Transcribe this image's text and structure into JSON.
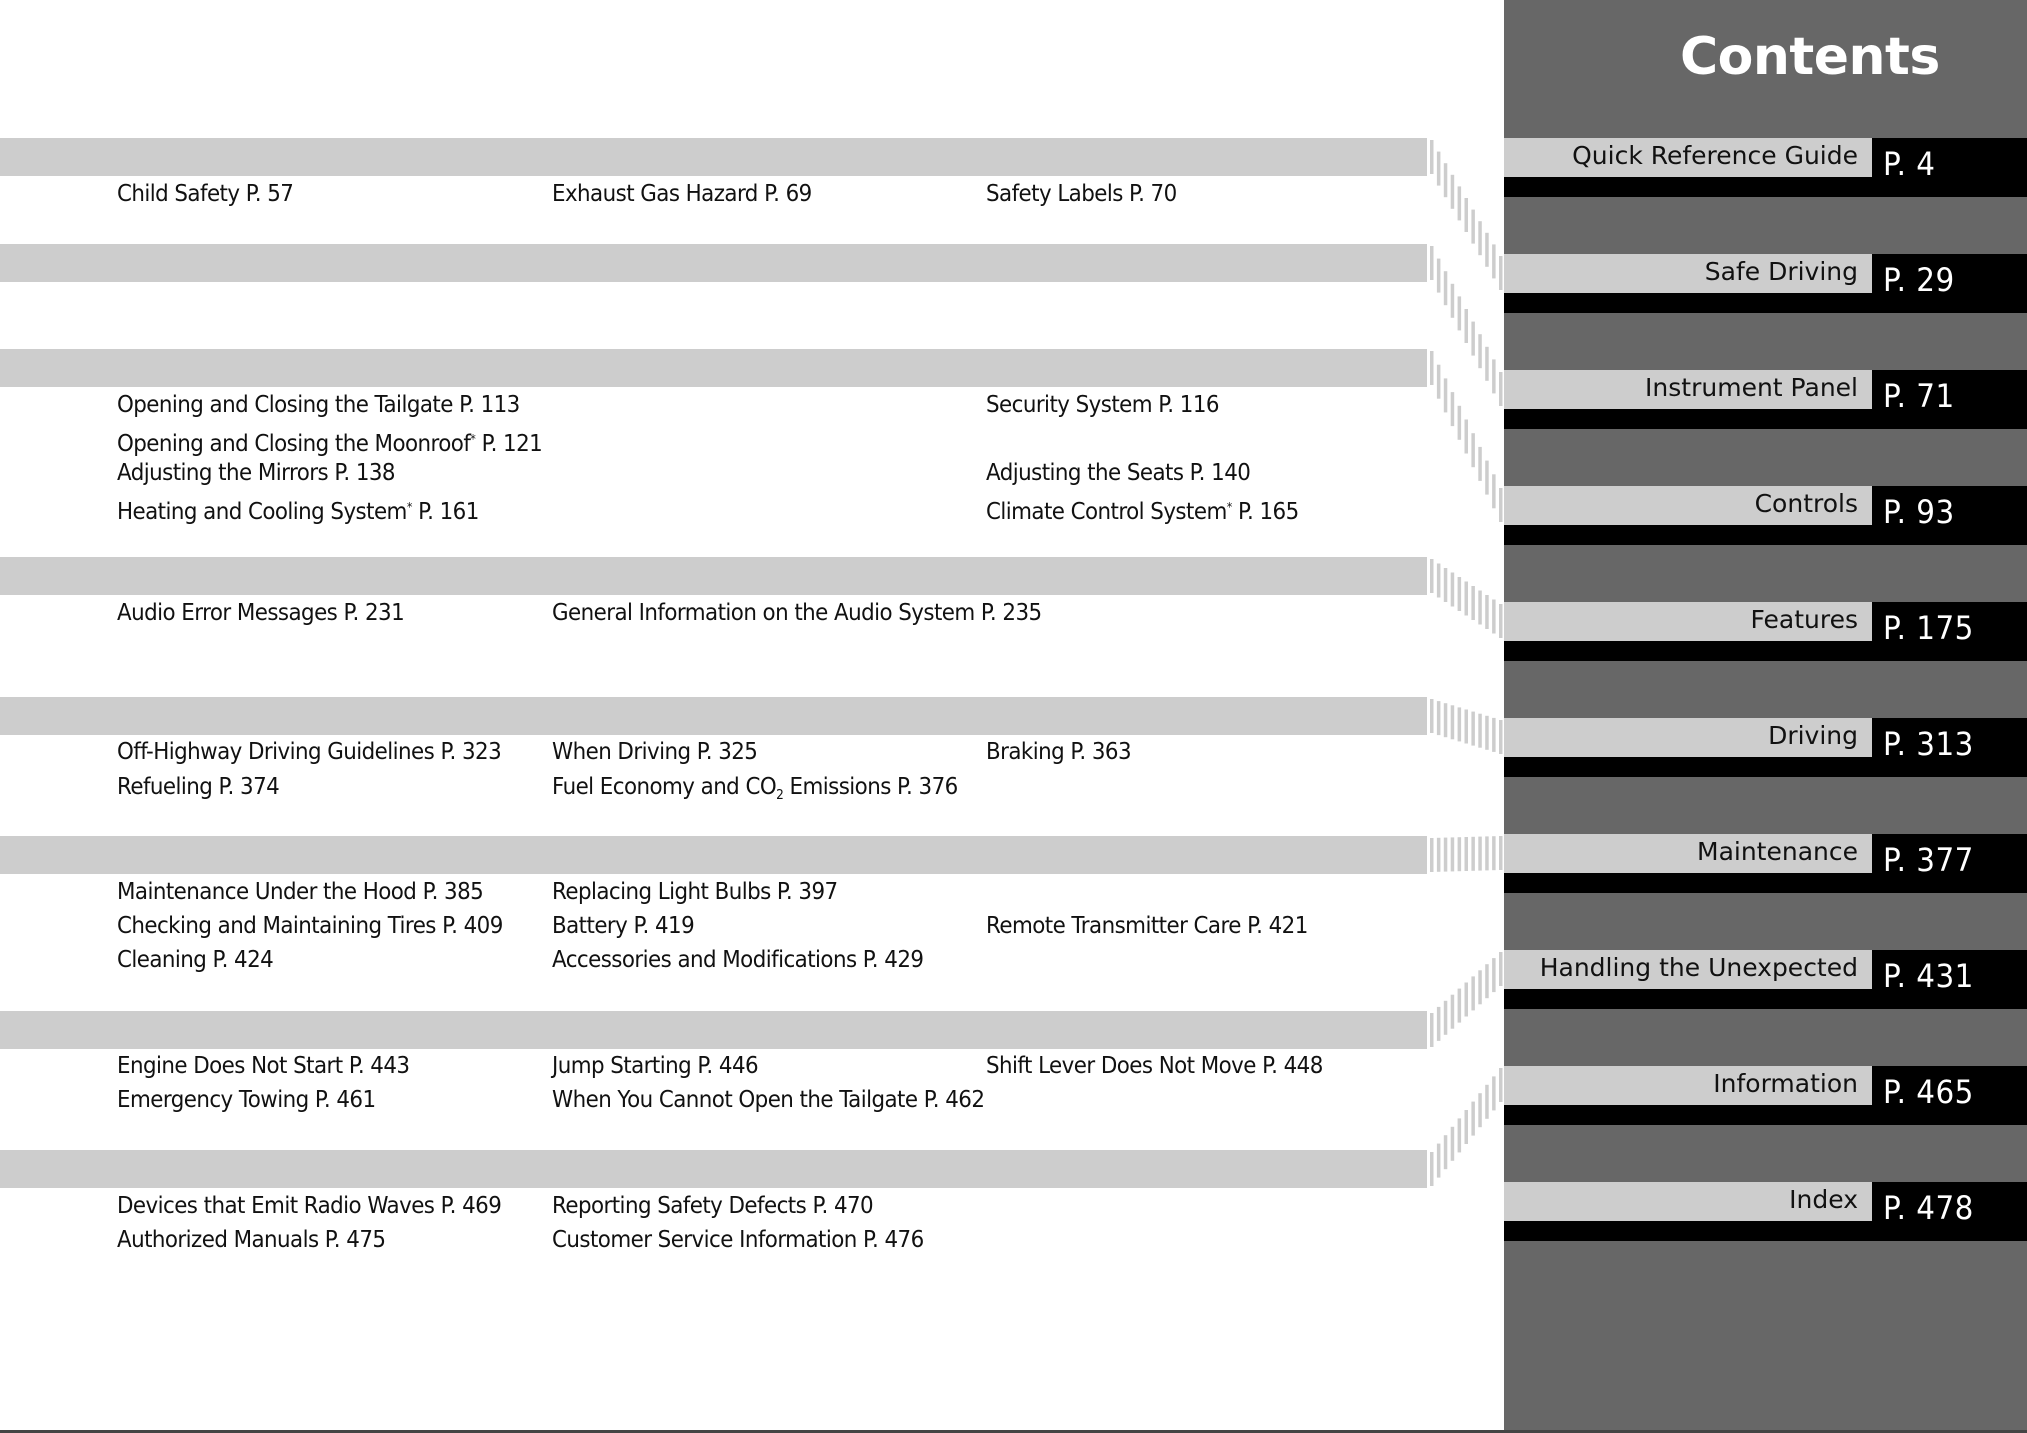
{
  "title": "Contents",
  "sections": [
    {
      "label": "Quick Reference Guide",
      "page": "P. 4",
      "topics": []
    },
    {
      "label": "Safe Driving",
      "page": "P. 29",
      "topics": [
        {
          "text": "Child Safety P. 57"
        },
        {
          "text": "Exhaust Gas Hazard P. 69"
        },
        {
          "text": "Safety Labels P. 70"
        }
      ]
    },
    {
      "label": "Instrument Panel",
      "page": "P. 71",
      "topics": []
    },
    {
      "label": "Controls",
      "page": "P. 93",
      "topics": [
        {
          "text": "Opening and Closing the Tailgate P. 113"
        },
        {
          "text": "Security System P. 116"
        },
        {
          "pre": "Opening and Closing the Moonroof",
          "mark": "*",
          "post": " P. 121"
        },
        {
          "text": "Adjusting the Mirrors P. 138"
        },
        {
          "text": "Adjusting the Seats P. 140"
        },
        {
          "pre": "Heating and Cooling System",
          "mark": "*",
          "post": " P. 161"
        },
        {
          "pre": "Climate Control System",
          "mark": "*",
          "post": " P. 165"
        }
      ]
    },
    {
      "label": "Features",
      "page": "P. 175",
      "topics": [
        {
          "text": "Audio Error Messages P. 231"
        },
        {
          "text": "General Information on the Audio System P. 235"
        }
      ]
    },
    {
      "label": "Driving",
      "page": "P. 313",
      "topics": [
        {
          "text": "Off-Highway Driving Guidelines P. 323"
        },
        {
          "text": "When Driving P. 325"
        },
        {
          "text": "Braking P. 363"
        },
        {
          "text": "Refueling P. 374"
        },
        {
          "pre": "Fuel Economy and CO",
          "sub": "2",
          "post": " Emissions P. 376"
        }
      ]
    },
    {
      "label": "Maintenance",
      "page": "P. 377",
      "topics": [
        {
          "text": "Maintenance Under the Hood P. 385"
        },
        {
          "text": "Replacing Light Bulbs P. 397"
        },
        {
          "text": "Checking and Maintaining Tires P. 409"
        },
        {
          "text": "Battery P. 419"
        },
        {
          "text": "Remote Transmitter Care P. 421"
        },
        {
          "text": "Cleaning P. 424"
        },
        {
          "text": "Accessories and Modifications P. 429"
        }
      ]
    },
    {
      "label": "Handling the Unexpected",
      "page": "P. 431",
      "topics": [
        {
          "text": "Engine Does Not Start P. 443"
        },
        {
          "text": "Jump Starting P. 446"
        },
        {
          "text": "Shift Lever Does Not Move P. 448"
        },
        {
          "text": "Emergency Towing P. 461"
        },
        {
          "text": "When You Cannot Open the Tailgate P. 462"
        }
      ]
    },
    {
      "label": "Information",
      "page": "P. 465",
      "topics": [
        {
          "text": "Devices that Emit Radio Waves P. 469"
        },
        {
          "text": "Reporting Safety Defects P. 470"
        },
        {
          "text": "Authorized Manuals P. 475"
        },
        {
          "text": "Customer Service Information P. 476"
        }
      ]
    },
    {
      "label": "Index",
      "page": "P. 478",
      "topics": []
    }
  ],
  "colors": {
    "band": "#cdcdcd",
    "panel": "#676767",
    "page_box": "#000000",
    "text": "#111111"
  }
}
